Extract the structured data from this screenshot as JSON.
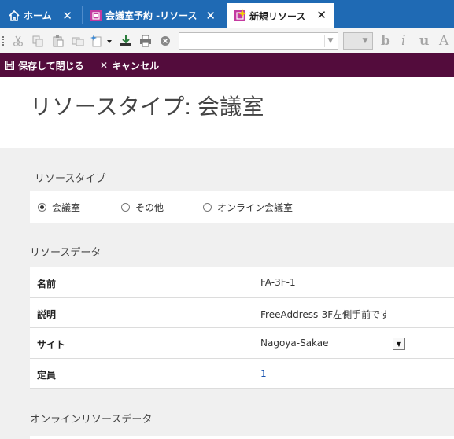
{
  "tabs": [
    {
      "label": "ホーム",
      "icon": "home-icon"
    },
    {
      "label": "会議室予約 -リソース",
      "icon": "calendar-icon"
    },
    {
      "label": "新規リソース",
      "icon": "new-record-icon",
      "active": true
    }
  ],
  "tab_close_glyph": "✕",
  "toolbar": {
    "icons": [
      "cut-icon",
      "copy-icon",
      "paste-icon",
      "duplicate-icon",
      "new-icon",
      "download-icon",
      "print-icon",
      "delete-icon"
    ],
    "font_value": "",
    "size_value": "",
    "format_buttons": [
      {
        "label": "b",
        "name": "bold-icon"
      },
      {
        "label": "i",
        "name": "italic-icon"
      },
      {
        "label": "u",
        "name": "underline-icon"
      },
      {
        "label": "A",
        "name": "font-color-icon"
      }
    ]
  },
  "commands": {
    "save_close_label": "保存して閉じる",
    "cancel_label": "キャンセル",
    "cancel_glyph": "✕"
  },
  "page": {
    "title": "リソースタイプ: 会議室"
  },
  "resource_type": {
    "section_label": "リソースタイプ",
    "options": [
      {
        "label": "会議室",
        "selected": true
      },
      {
        "label": "その他",
        "selected": false
      },
      {
        "label": "オンライン会議室",
        "selected": false
      }
    ]
  },
  "resource_data": {
    "section_label": "リソースデータ",
    "rows": [
      {
        "label": "名前",
        "value": "FA-3F-1"
      },
      {
        "label": "説明",
        "value": "FreeAddress-3F左側手前です"
      },
      {
        "label": "サイト",
        "value": "Nagoya-Sakae"
      },
      {
        "label": "定員",
        "value": "1"
      }
    ]
  },
  "online_resource_data": {
    "section_label": "オンラインリソースデータ"
  },
  "colors": {
    "tabbar": "#1f6ab4",
    "command_bar": "#530c3c",
    "content_bg": "#f0f0f0",
    "link": "#1a55b0"
  }
}
